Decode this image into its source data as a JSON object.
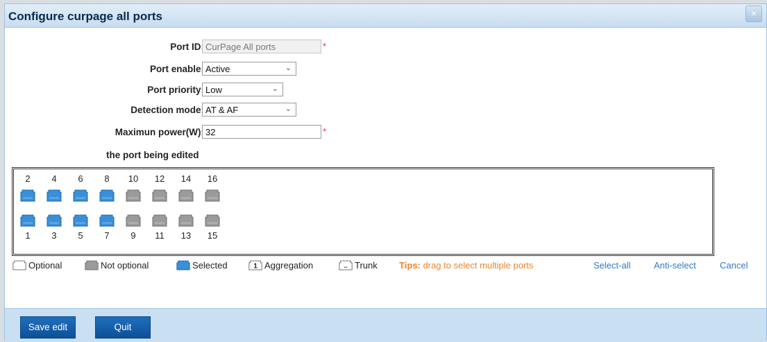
{
  "dialog": {
    "title": "Configure curpage all ports",
    "close_symbol": "×"
  },
  "form": {
    "port_id": {
      "label": "Port ID:",
      "value": "CurPage All ports",
      "required_mark": "*"
    },
    "port_enable": {
      "label": "Port enable:",
      "value": "Active"
    },
    "port_priority": {
      "label": "Port priority:",
      "value": "Low"
    },
    "detection_mode": {
      "label": "Detection mode:",
      "value": "AT & AF"
    },
    "max_power": {
      "label": "Maximun power(W):",
      "value": "32",
      "required_mark": "*"
    }
  },
  "ports_section_label": "the port being edited",
  "ports": {
    "top_row": [
      {
        "id": "2",
        "state": "selected"
      },
      {
        "id": "4",
        "state": "selected"
      },
      {
        "id": "6",
        "state": "selected"
      },
      {
        "id": "8",
        "state": "selected"
      },
      {
        "id": "10",
        "state": "not_optional"
      },
      {
        "id": "12",
        "state": "not_optional"
      },
      {
        "id": "14",
        "state": "not_optional"
      },
      {
        "id": "16",
        "state": "not_optional"
      }
    ],
    "bottom_row": [
      {
        "id": "1",
        "state": "selected"
      },
      {
        "id": "3",
        "state": "selected"
      },
      {
        "id": "5",
        "state": "selected"
      },
      {
        "id": "7",
        "state": "selected"
      },
      {
        "id": "9",
        "state": "not_optional"
      },
      {
        "id": "11",
        "state": "not_optional"
      },
      {
        "id": "13",
        "state": "not_optional"
      },
      {
        "id": "15",
        "state": "not_optional"
      }
    ]
  },
  "legend": {
    "optional": "Optional",
    "not_optional": "Not optional",
    "selected": "Selected",
    "aggregation": "Aggregation",
    "aggregation_badge": "1",
    "trunk": "Trunk",
    "trunk_badge": ".."
  },
  "tips": {
    "prefix": "Tips:",
    "text": " drag to select multiple ports"
  },
  "actions": {
    "select_all": "Select-all",
    "anti_select": "Anti-select",
    "cancel": "Cancel"
  },
  "buttons": {
    "save": "Save edit",
    "quit": "Quit"
  },
  "colors": {
    "selected": "#3a8fd9",
    "not_optional": "#9b9b9b",
    "tips": "#f08428",
    "link": "#2f7ac3"
  }
}
